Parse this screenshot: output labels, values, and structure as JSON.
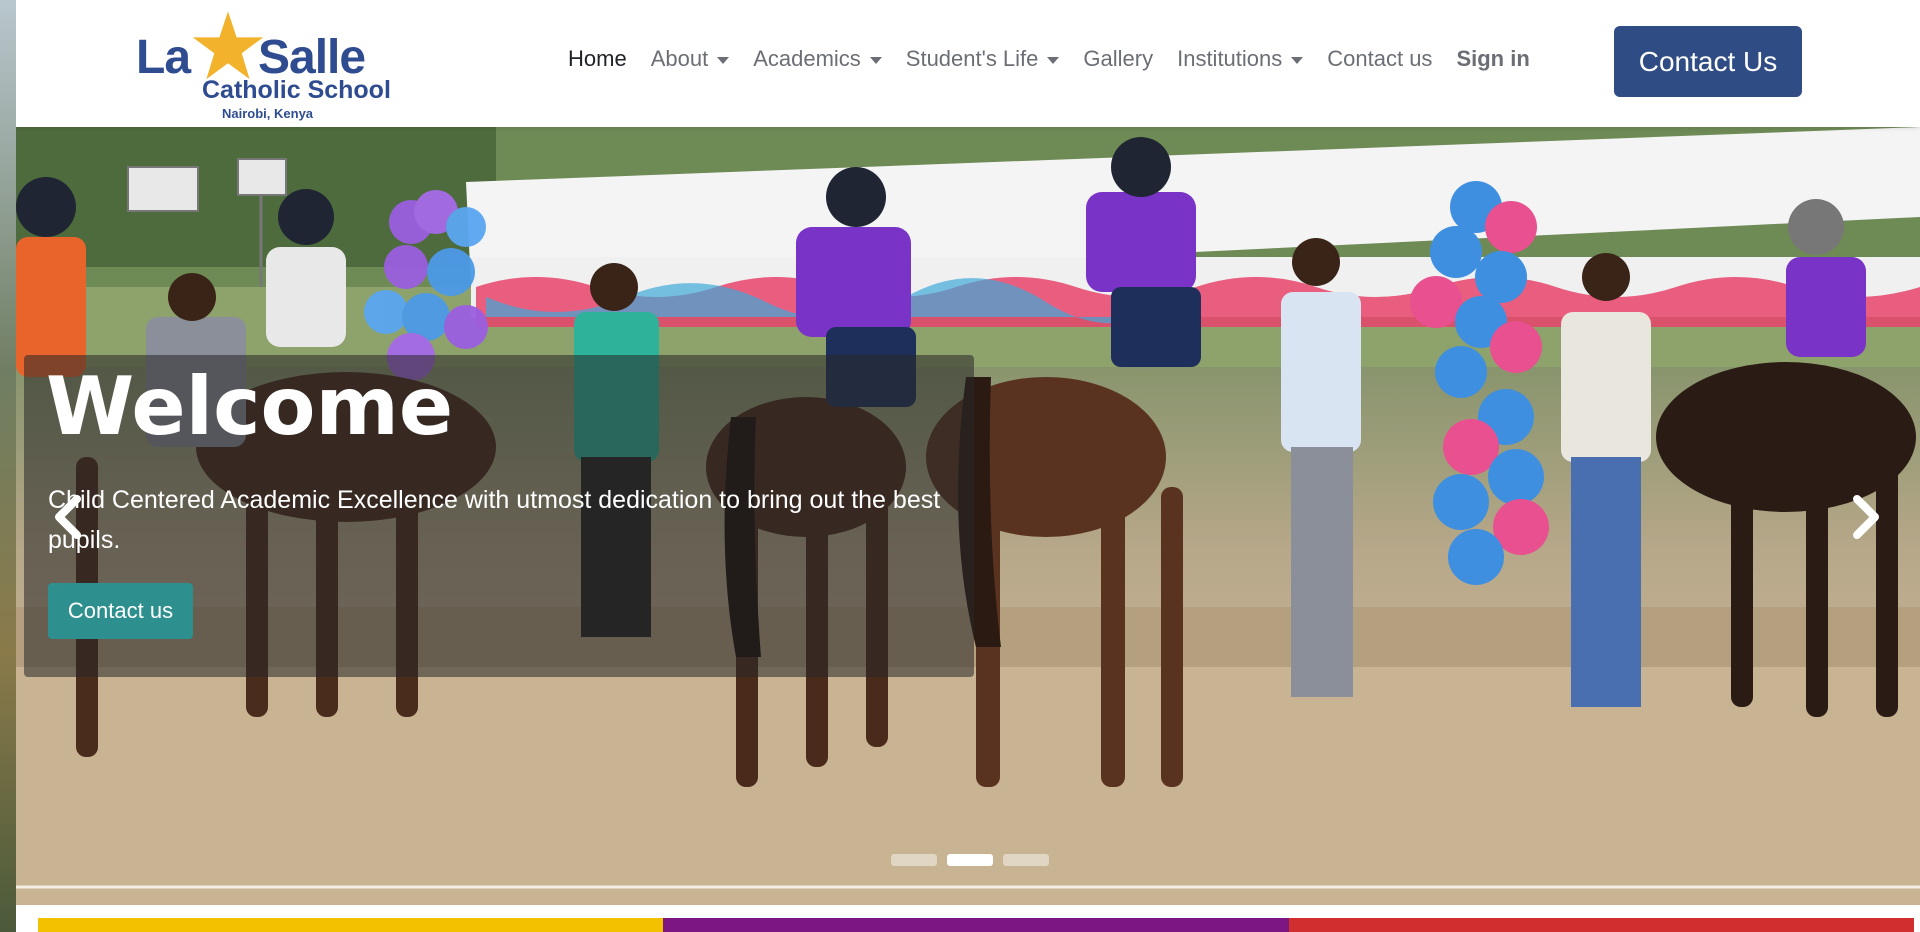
{
  "logo": {
    "name_left": "La",
    "name_right": "Salle",
    "subtitle": "Catholic School",
    "location": "Nairobi, Kenya",
    "brand_color": "#2f4c91",
    "star_color": "#f2b22b"
  },
  "nav": {
    "items": [
      {
        "label": "Home",
        "active": true,
        "dropdown": false
      },
      {
        "label": "About",
        "active": false,
        "dropdown": true
      },
      {
        "label": "Academics",
        "active": false,
        "dropdown": true
      },
      {
        "label": "Student's Life",
        "active": false,
        "dropdown": true
      },
      {
        "label": "Gallery",
        "active": false,
        "dropdown": false
      },
      {
        "label": "Institutions",
        "active": false,
        "dropdown": true
      },
      {
        "label": "Contact us",
        "active": false,
        "dropdown": false
      },
      {
        "label": "Sign in",
        "active": false,
        "dropdown": false
      }
    ],
    "cta_label": "Contact Us",
    "cta_color": "#2f4c85"
  },
  "hero": {
    "title": "Welcome",
    "text": "Child Centered Academic Excellence with utmost dedication to bring out the best pupils.",
    "button_label": "Contact us",
    "button_color": "#2e8f8f",
    "prev_icon": "chevron-left-icon",
    "next_icon": "chevron-right-icon",
    "slide_count": 3,
    "active_slide": 2
  },
  "color_bar": [
    "#f2c200",
    "#7b1683",
    "#d12f2f"
  ]
}
